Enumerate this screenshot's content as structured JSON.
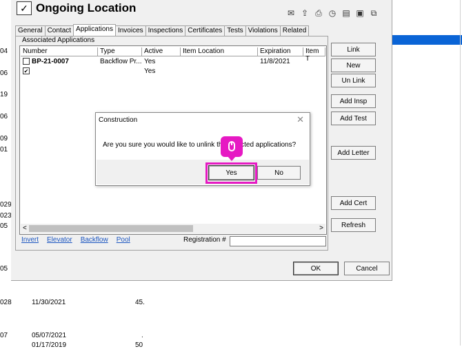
{
  "background": {
    "rows": [
      {
        "id": "r04",
        "text": "04"
      },
      {
        "id": "r06a",
        "text": "06"
      },
      {
        "id": "r19",
        "text": "19"
      },
      {
        "id": "r06b",
        "text": "06"
      },
      {
        "id": "r09",
        "text": "09"
      },
      {
        "id": "r01",
        "text": "01"
      },
      {
        "id": "r029",
        "text": "029"
      },
      {
        "id": "r023",
        "text": "023"
      },
      {
        "id": "r05a",
        "text": "05"
      },
      {
        "id": "r05b",
        "text": "05"
      },
      {
        "id": "r028",
        "text": "028"
      },
      {
        "id": "r07",
        "text": "07"
      },
      {
        "id": "r028_date",
        "text": "11/30/2021"
      },
      {
        "id": "r028_val",
        "text": "45."
      },
      {
        "id": "r07_date",
        "text": "05/07/2021"
      },
      {
        "id": "r07_val",
        "text": "."
      },
      {
        "id": "rbottom_date",
        "text": "01/17/2019"
      },
      {
        "id": "rbottom_val",
        "text": "50"
      }
    ]
  },
  "window": {
    "title": "Ongoing Location",
    "toolbar_icons": [
      "envelope-icon",
      "export-icon",
      "print-icon",
      "clock-icon",
      "document-icon",
      "save-icon",
      "copy-icon"
    ]
  },
  "tabs": [
    "General",
    "Contact",
    "Applications",
    "Invoices",
    "Inspections",
    "Certificates",
    "Tests",
    "Violations",
    "Related"
  ],
  "active_tab": "Applications",
  "group_label": "Associated Applications",
  "grid": {
    "columns": [
      "Number",
      "Type",
      "Active",
      "Item Location",
      "Expiration",
      "Item T"
    ],
    "rows": [
      {
        "checked": false,
        "number": "BP-21-0007",
        "type": "Backflow Pr...",
        "active": "Yes",
        "item_location": "",
        "expiration": "11/8/2021"
      },
      {
        "checked": true,
        "number": "",
        "type": "",
        "active": "Yes",
        "item_location": "",
        "expiration": ""
      }
    ],
    "scroll_left": "<",
    "scroll_right": ">"
  },
  "links": [
    "Invert",
    "Elevator",
    "Backflow",
    "Pool"
  ],
  "registration_label": "Registration #",
  "registration_value": "",
  "side_buttons": {
    "link": "Link",
    "new": "New",
    "unlink": "Un Link",
    "add_insp": "Add Insp",
    "add_test": "Add Test",
    "add_letter": "Add Letter",
    "add_cert": "Add Cert",
    "refresh": "Refresh"
  },
  "footer": {
    "ok": "OK",
    "cancel": "Cancel"
  },
  "dialog": {
    "title": "Construction",
    "close": "✕",
    "message": "Are you sure you would like to unlink the selected applications?",
    "yes": "Yes",
    "no": "No"
  },
  "highlight_color": "#e619c3"
}
